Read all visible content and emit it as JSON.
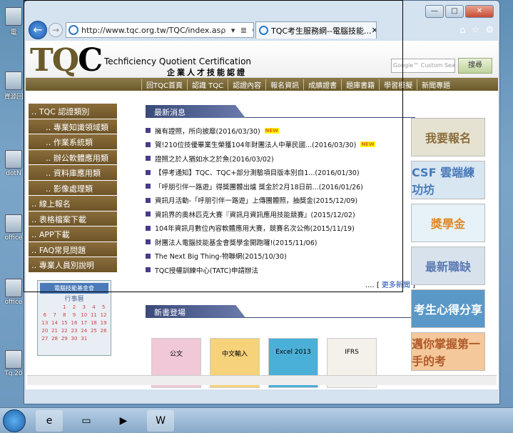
{
  "desktop": {
    "icons": [
      {
        "label": "電"
      },
      {
        "label": "資源回"
      },
      {
        "label": "dotN"
      },
      {
        "label": "office"
      },
      {
        "label": "office"
      },
      {
        "label": "Tq.20"
      }
    ]
  },
  "browser": {
    "url": "http://www.tqc.org.tw/TQC/index.as",
    "tab_title": "TQC考生服務網--電腦技能...",
    "addr_tools": "ρ ▾ ≣ C ✕"
  },
  "header": {
    "tagline": "Techficiency Quotient Certification",
    "tagline_zh": "企業人才技能認證",
    "search_placeholder": "Google™ Custom Sea",
    "search_button": "搜尋"
  },
  "menu": [
    "回TQC首頁",
    "認識 TQC",
    "認證內容",
    "報名資訊",
    "成績證書",
    "題庫書籍",
    "學習模擬",
    "新聞專題"
  ],
  "sidebar": {
    "items": [
      {
        "label": "‥ TQC 認證類別",
        "sub": false
      },
      {
        "label": "‥ 專業知識領域類",
        "sub": true
      },
      {
        "label": "‥ 作業系統類",
        "sub": true
      },
      {
        "label": "‥ 辦公軟體應用類",
        "sub": true
      },
      {
        "label": "‥ 資料庫應用類",
        "sub": true
      },
      {
        "label": "‥ 影像處理類",
        "sub": true
      },
      {
        "label": "‥ 線上報名",
        "sub": false
      },
      {
        "label": "‥ 表格檔案下載",
        "sub": false
      },
      {
        "label": "‥ APP下載",
        "sub": false
      },
      {
        "label": "‥ FAQ常見問題",
        "sub": false
      },
      {
        "label": "‥ 專業人員別說明",
        "sub": false
      }
    ],
    "calendar": {
      "title": "電腦技能基金會",
      "subtitle": "行事曆",
      "days": [
        "",
        "",
        "1",
        "2",
        "3",
        "4",
        "5",
        "6",
        "7",
        "8",
        "9",
        "10",
        "11",
        "12",
        "13",
        "14",
        "15",
        "16",
        "17",
        "18",
        "19",
        "20",
        "21",
        "22",
        "23",
        "24",
        "25",
        "26",
        "27",
        "28",
        "29",
        "30",
        "31"
      ]
    }
  },
  "news": {
    "title": "最新消息",
    "new_badge": "NEW",
    "items": [
      {
        "text": "擁有證照，所向披靡(2016/03/30)",
        "new": true
      },
      {
        "text": "賀!210位技優畢業生榮獲104年財團法人中華民國...(2016/03/30)",
        "new": true
      },
      {
        "text": "證照之於人猶如水之於魚(2016/03/02)",
        "new": false
      },
      {
        "text": "【停考通知】TQC、TQC+部分測驗項目版本別自1...(2016/01/30)",
        "new": false
      },
      {
        "text": "「呼朋引伴一路遊」得獎團體出爐 獎金於2月18日前...(2016/01/26)",
        "new": false
      },
      {
        "text": "資訊月活動-「呼朋引伴一路遊」上傳團體照，抽獎金(2015/12/09)",
        "new": false
      },
      {
        "text": "資訊界的奧林匹克大賽『資訊月資訊應用技能競賽』(2015/12/02)",
        "new": false
      },
      {
        "text": "104年資訊月數位內容軟體應用大賽，競賽名次公佈(2015/11/19)",
        "new": false
      },
      {
        "text": "財團法人電腦技能基金會獎學金開跑囉!(2015/11/06)",
        "new": false
      },
      {
        "text": "The Next Big Thing-物聯網(2015/10/30)",
        "new": false
      },
      {
        "text": "TQC授權訓練中心(TATC)申請辦法",
        "new": false
      }
    ],
    "more": "更多新聞"
  },
  "books": {
    "title": "新書登場",
    "items": [
      {
        "label": "公文"
      },
      {
        "label": "中文輸入"
      },
      {
        "label": "Excel 2013"
      },
      {
        "label": "IFRS"
      }
    ]
  },
  "right_banners": [
    {
      "label": "我要報名",
      "bg": "#e6e2d2",
      "color": "#8a6d3b"
    },
    {
      "label": "CSF 雲端練功坊",
      "bg": "#d8e6f2",
      "color": "#4a7ab8"
    },
    {
      "label": "獎學金",
      "bg": "#e6f2f8",
      "color": "#e08a2a"
    },
    {
      "label": "最新職缺",
      "bg": "#d8e2ec",
      "color": "#5a7ab0"
    },
    {
      "label": "考生心得分享",
      "bg": "#5a98c8",
      "color": "#ffffff"
    },
    {
      "label": "邁你掌握第一手的考",
      "bg": "#f4c89a",
      "color": "#b05a2a"
    }
  ]
}
